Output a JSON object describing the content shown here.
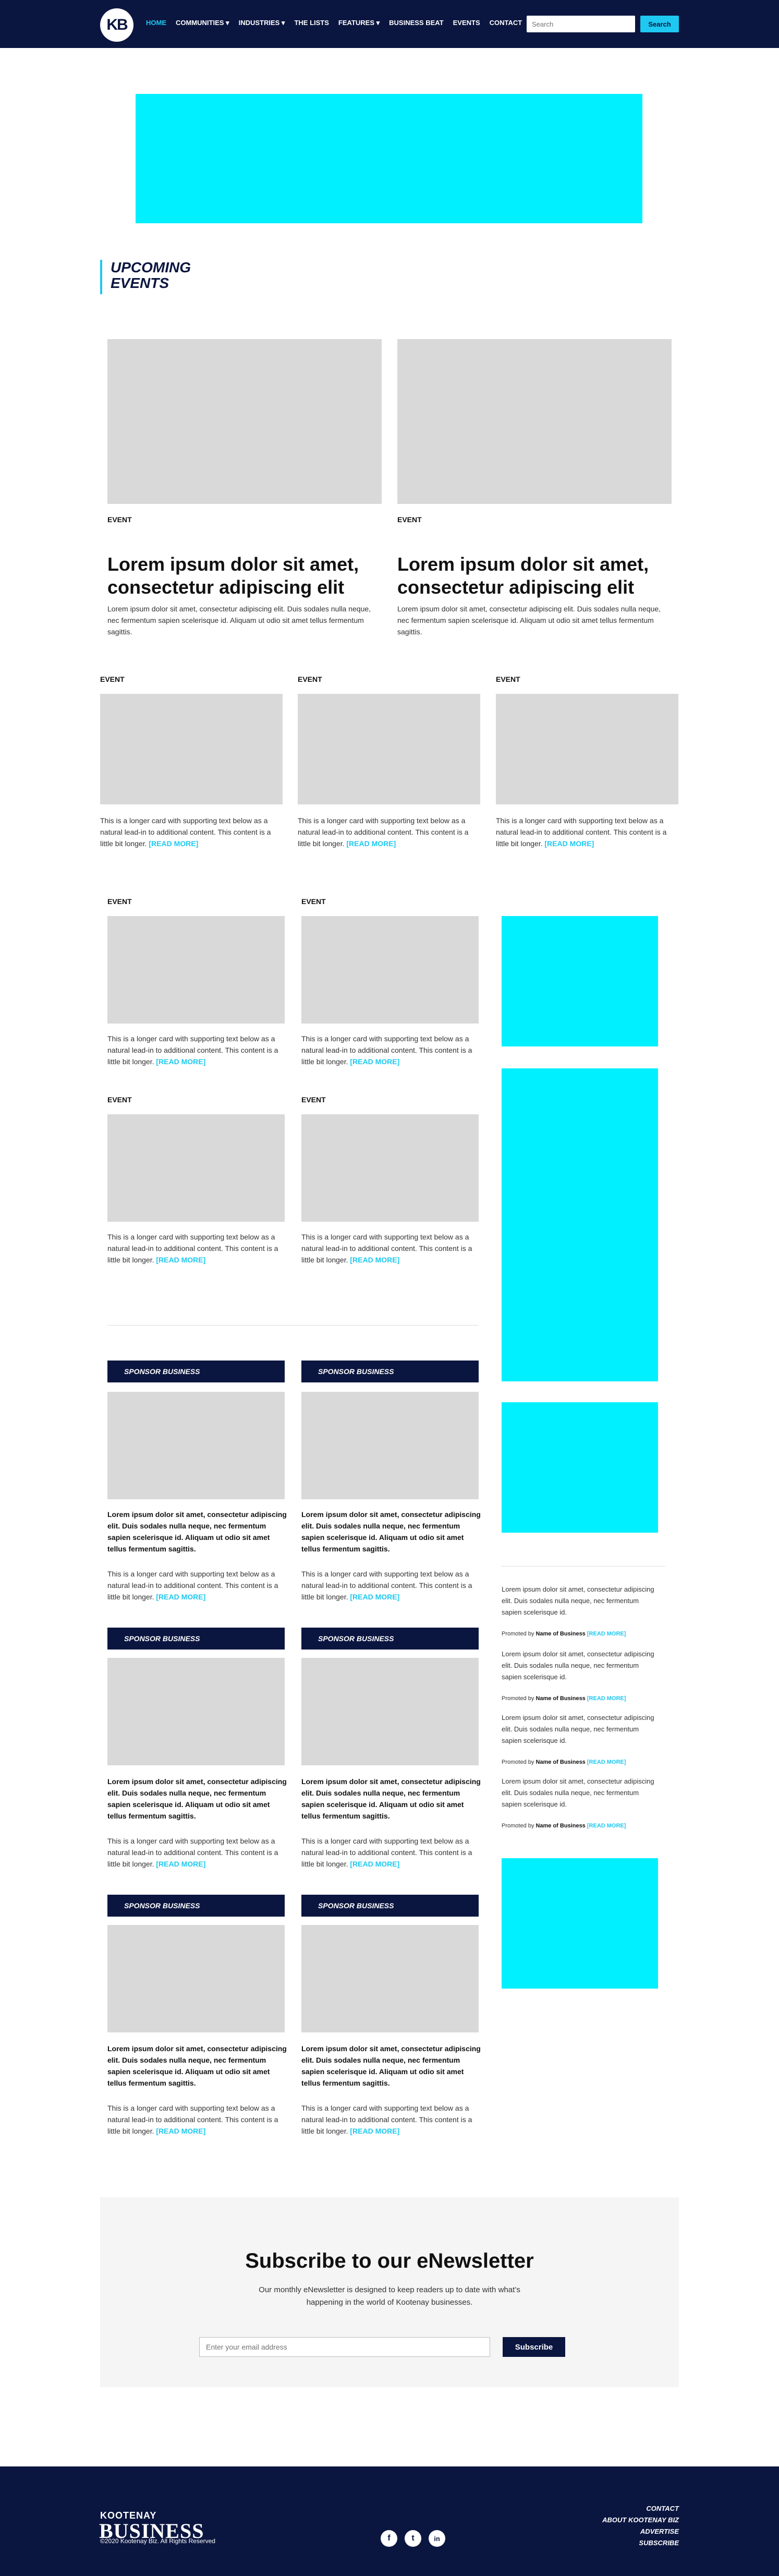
{
  "header": {
    "logo": "KB",
    "nav": [
      "HOME",
      "COMMUNITIES ▾",
      "INDUSTRIES ▾",
      "THE LISTS",
      "FEATURES ▾",
      "BUSINESS BEAT",
      "EVENTS",
      "CONTACT"
    ],
    "search_placeholder": "Search",
    "search_button": "Search"
  },
  "section_title": "UPCOMING EVENTS",
  "featured": [
    {
      "label": "EVENT",
      "title": "Lorem ipsum dolor sit amet, consectetur adipiscing elit",
      "text": "Lorem ipsum dolor sit amet, consectetur adipiscing elit. Duis sodales nulla neque, nec fermentum sapien scelerisque id. Aliquam ut odio sit amet tellus fermentum sagittis."
    },
    {
      "label": "EVENT",
      "title": "Lorem ipsum dolor sit amet, consectetur adipiscing elit",
      "text": "Lorem ipsum dolor sit amet, consectetur adipiscing elit. Duis sodales nulla neque, nec fermentum sapien scelerisque id. Aliquam ut odio sit amet tellus fermentum sagittis."
    }
  ],
  "card_text": "This is a longer card with supporting text below as a natural lead-in to additional content. This content is a little bit longer.",
  "read_more": "[READ MORE]",
  "event_label": "EVENT",
  "sponsor_label": "SPONSOR BUSINESS",
  "sponsor_title": "Lorem ipsum dolor sit amet, consectetur adipiscing elit. Duis sodales nulla neque, nec fermentum sapien scelerisque id. Aliquam ut odio sit amet tellus fermentum sagittis.",
  "sidebar_text": "Lorem ipsum dolor sit amet, consectetur adipiscing elit. Duis sodales nulla neque, nec fermentum sapien scelerisque id.",
  "promoted_by": "Promoted by",
  "business_name": "Name of Business",
  "newsletter": {
    "title": "Subscribe to our eNewsletter",
    "desc": "Our monthly eNewsletter is designed to keep readers up to date with what’s happening in the world of Kootenay businesses.",
    "placeholder": "Enter your email address",
    "button": "Subscribe"
  },
  "footer": {
    "logo_top": "KOOTENAY",
    "logo_bottom": "BUSINESS",
    "copyright": "©2020 Kootenay Biz. All Rights Reserved",
    "links": [
      "CONTACT",
      "ABOUT KOOTENAY BIZ",
      "ADVERTISE",
      "SUBSCRIBE"
    ],
    "social": [
      "f",
      "t",
      "in"
    ]
  }
}
